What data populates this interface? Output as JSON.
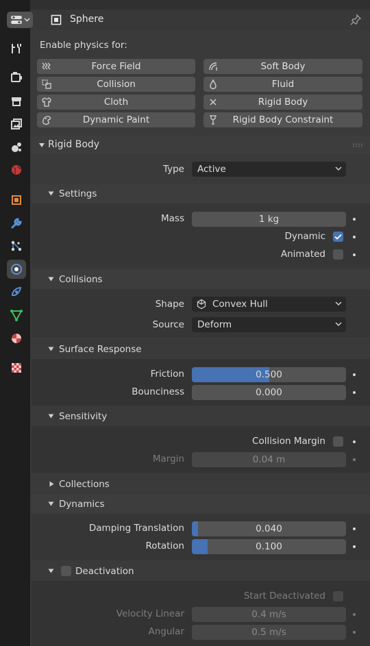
{
  "header": {
    "object_name": "Sphere"
  },
  "tabs": [
    "tool",
    "render",
    "output",
    "view-layer",
    "scene",
    "world",
    "object",
    "modifiers",
    "particles",
    "physics",
    "object-constraints",
    "object-data",
    "material",
    "texture"
  ],
  "enable_physics": {
    "heading": "Enable physics for:",
    "buttons": [
      "Force Field",
      "Soft Body",
      "Collision",
      "Fluid",
      "Cloth",
      "Rigid Body",
      "Dynamic Paint",
      "Rigid Body Constraint"
    ]
  },
  "rigid_body": {
    "title": "Rigid Body",
    "type_label": "Type",
    "type_value": "Active",
    "settings": {
      "title": "Settings",
      "mass_label": "Mass",
      "mass_value": "1 kg",
      "dynamic_label": "Dynamic",
      "dynamic_checked": true,
      "animated_label": "Animated",
      "animated_checked": false
    },
    "collisions": {
      "title": "Collisions",
      "shape_label": "Shape",
      "shape_value": "Convex Hull",
      "source_label": "Source",
      "source_value": "Deform",
      "surface_response": {
        "title": "Surface Response",
        "friction_label": "Friction",
        "friction_value": "0.500",
        "friction_fraction": 0.5,
        "bounciness_label": "Bounciness",
        "bounciness_value": "0.000"
      },
      "sensitivity": {
        "title": "Sensitivity",
        "collision_margin_label": "Collision Margin",
        "margin_label": "Margin",
        "margin_value": "0.04 m"
      },
      "collections": {
        "title": "Collections"
      }
    },
    "dynamics": {
      "title": "Dynamics",
      "damping_translation_label": "Damping Translation",
      "damping_translation_value": "0.040",
      "damping_translation_fraction": 0.04,
      "rotation_label": "Rotation",
      "rotation_value": "0.100",
      "rotation_fraction": 0.1,
      "deactivation": {
        "title": "Deactivation",
        "start_deactivated_label": "Start Deactivated",
        "velocity_linear_label": "Velocity Linear",
        "velocity_linear_value": "0.4 m/s",
        "angular_label": "Angular",
        "angular_value": "0.5 m/s"
      }
    }
  },
  "colors": {
    "accent": "#4772b3",
    "panel_bg": "#3a3a3a",
    "field_bg": "#545454"
  }
}
